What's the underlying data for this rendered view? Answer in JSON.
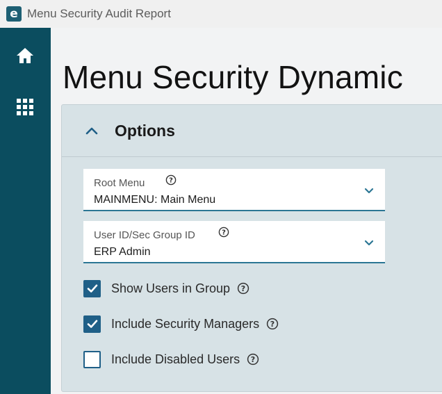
{
  "window": {
    "logo_letter": "e",
    "title": "Menu Security Audit Report"
  },
  "sidebar": {
    "items": [
      {
        "icon": "home-icon"
      },
      {
        "icon": "apps-grid-icon"
      }
    ]
  },
  "page": {
    "title": "Menu Security Dynamic"
  },
  "options": {
    "header": "Options",
    "fields": [
      {
        "label": "Root Menu",
        "value": "MAINMENU: Main Menu"
      },
      {
        "label": "User ID/Sec Group ID",
        "value": "ERP Admin"
      }
    ],
    "checkboxes": [
      {
        "label": "Show Users in Group",
        "checked": true
      },
      {
        "label": "Include Security Managers",
        "checked": true
      },
      {
        "label": "Include Disabled Users",
        "checked": false
      }
    ]
  },
  "colors": {
    "sidebar": "#0b4d5f",
    "accent": "#1f5f87",
    "panel": "#d7e2e6"
  }
}
